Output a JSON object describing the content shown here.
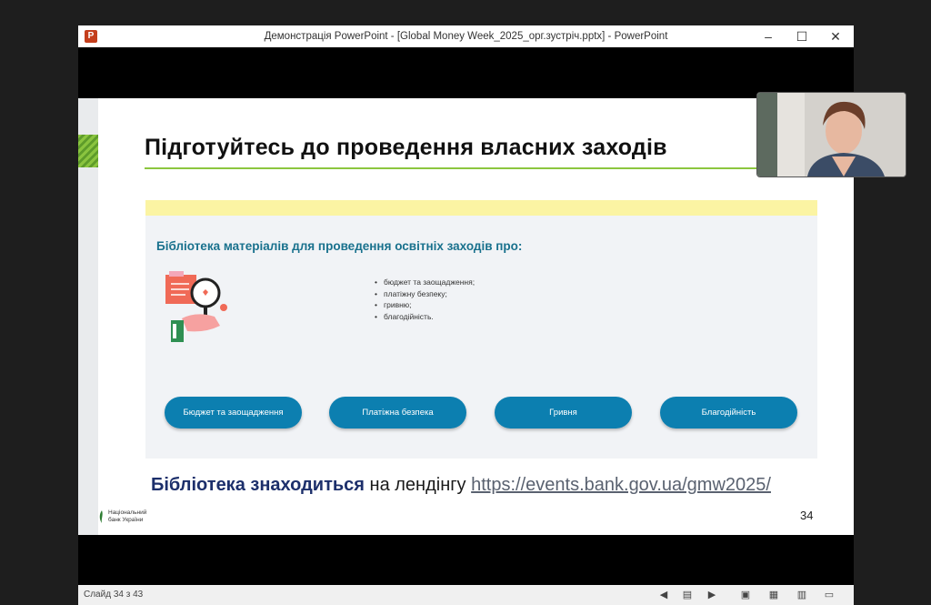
{
  "window": {
    "title": "Демонстрація PowerPoint - [Global Money Week_2025_орг.зустріч.pptx] - PowerPoint",
    "app_icon": "powerpoint-icon",
    "minimize": "–",
    "maximize": "☐",
    "close": "✕"
  },
  "slide": {
    "title": "Підготуйтесь до проведення власних заходів",
    "panel_heading": "Бібліотека матеріалів для проведення освітніх заходів про:",
    "bullets": [
      "бюджет та заощадження;",
      "платіжну безпеку;",
      "гривню;",
      "благодійність."
    ],
    "buttons": [
      "Бюджет та заощадження",
      "Платіжна безпека",
      "Гривня",
      "Благодійність"
    ],
    "library_bold": "Бібліотека знаходиться",
    "library_text": " на лендінгу ",
    "library_link": "https://events.bank.gov.ua/gmw2025/",
    "logo_line1": "Національний",
    "logo_line2": "банк України",
    "number": "34"
  },
  "statusbar": {
    "counter": "Слайд 34 з 43",
    "icons": [
      "previous-icon",
      "slide-sorter-icon",
      "next-icon",
      "normal-view-icon",
      "grid-view-icon",
      "reading-view-icon",
      "presenter-view-icon"
    ]
  },
  "colors": {
    "accent_blue": "#0c7fb0",
    "heading_teal": "#19718d",
    "title_underline": "#8cc63f",
    "panel_yellow": "#fbf4a3"
  }
}
